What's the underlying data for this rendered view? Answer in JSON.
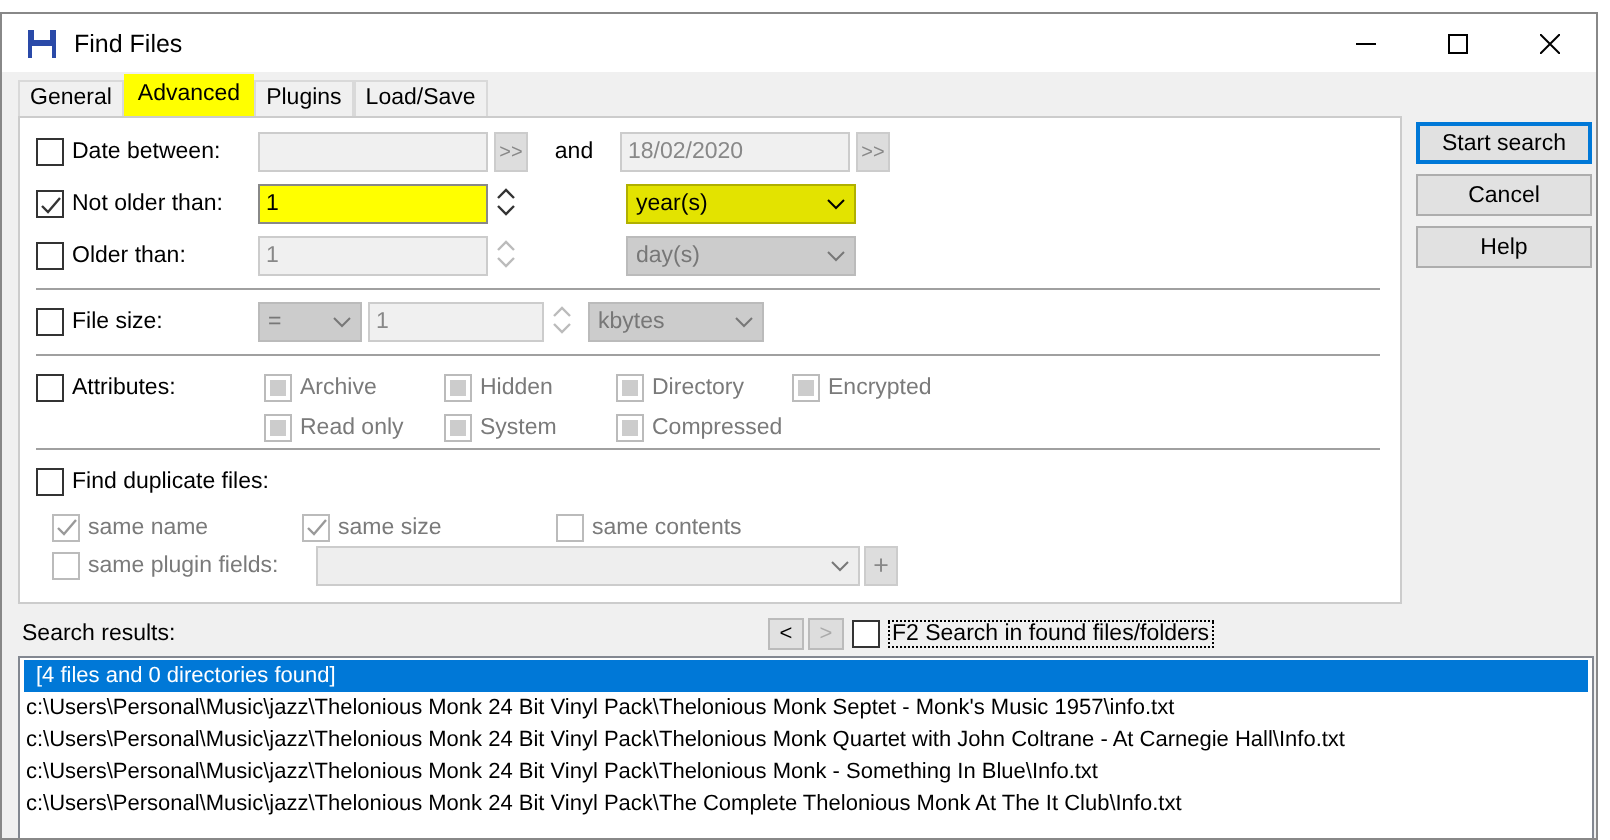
{
  "window": {
    "title": "Find Files"
  },
  "tabs": [
    {
      "label": "General",
      "selected": false
    },
    {
      "label": "Advanced",
      "selected": true
    },
    {
      "label": "Plugins",
      "selected": false
    },
    {
      "label": "Load/Save",
      "selected": false
    }
  ],
  "date_between": {
    "label": "Date between:",
    "checked": false,
    "browse": ">>",
    "conjunction": "and",
    "to_value": "18/02/2020",
    "to_browse": ">>"
  },
  "age_rows": [
    {
      "label": "Not older than:",
      "checked": true,
      "value": "1",
      "unit": "year(s)"
    },
    {
      "label": "Older than:",
      "checked": false,
      "value": "1",
      "unit": "day(s)"
    }
  ],
  "file_size": {
    "label": "File size:",
    "checked": false,
    "operator": "=",
    "value": "1",
    "unit": "kbytes"
  },
  "attributes": {
    "label": "Attributes:",
    "checked": false,
    "options": [
      {
        "label": "Archive",
        "disabled": true
      },
      {
        "label": "Hidden",
        "disabled": true
      },
      {
        "label": "Directory",
        "disabled": true
      },
      {
        "label": "Encrypted",
        "disabled": true
      },
      {
        "label": "Read only",
        "disabled": true
      },
      {
        "label": "System",
        "disabled": true
      },
      {
        "label": "Compressed",
        "disabled": true
      }
    ]
  },
  "duplicates": {
    "label": "Find duplicate files:",
    "checked": false,
    "options": [
      {
        "label": "same name",
        "checked": true
      },
      {
        "label": "same size",
        "checked": true
      },
      {
        "label": "same contents",
        "checked": false
      }
    ],
    "plugin": {
      "label": "same plugin fields:",
      "checked": false,
      "add": "+"
    }
  },
  "buttons": [
    {
      "label": "Start search",
      "default": true
    },
    {
      "label": "Cancel",
      "default": false
    },
    {
      "label": "Help",
      "default": false
    }
  ],
  "results": {
    "label": "Search results:",
    "prev": "<",
    "next": ">",
    "next_disabled": true,
    "search_found": {
      "label": "F2 Search in found files/folders",
      "checked": false
    },
    "items": [
      {
        "text": "[4 files and 0 directories found]",
        "selected": true
      },
      {
        "text": "c:\\Users\\Personal\\Music\\jazz\\Thelonious Monk 24 Bit Vinyl Pack\\Thelonious Monk Septet - Monk's Music 1957\\info.txt",
        "selected": false
      },
      {
        "text": "c:\\Users\\Personal\\Music\\jazz\\Thelonious Monk 24 Bit Vinyl Pack\\Thelonious Monk Quartet with John Coltrane - At Carnegie Hall\\Info.txt",
        "selected": false
      },
      {
        "text": "c:\\Users\\Personal\\Music\\jazz\\Thelonious Monk 24 Bit Vinyl Pack\\Thelonious Monk - Something In Blue\\Info.txt",
        "selected": false
      },
      {
        "text": "c:\\Users\\Personal\\Music\\jazz\\Thelonious Monk 24 Bit Vinyl Pack\\The Complete Thelonious Monk At The It Club\\Info.txt",
        "selected": false
      }
    ]
  }
}
